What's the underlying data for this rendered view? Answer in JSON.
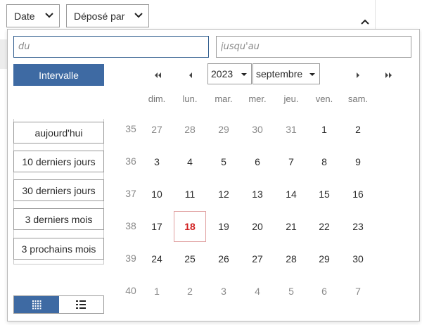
{
  "filters": {
    "date_label": "Date",
    "deposited_by_label": "Déposé par"
  },
  "inputs": {
    "from_placeholder": "du",
    "to_placeholder": "jusqu'au"
  },
  "interval_button": "Intervalle",
  "year": {
    "selected": "2023"
  },
  "month": {
    "selected": "septembre"
  },
  "presets": [
    "aujourd'hui",
    "10 derniers jours",
    "30 derniers jours",
    "3 derniers mois",
    "3 prochains mois"
  ],
  "weekdays": [
    "dim.",
    "lun.",
    "mar.",
    "mer.",
    "jeu.",
    "ven.",
    "sam."
  ],
  "weeks": [
    {
      "num": "35",
      "days": [
        {
          "d": "27",
          "other": true
        },
        {
          "d": "28",
          "other": true
        },
        {
          "d": "29",
          "other": true
        },
        {
          "d": "30",
          "other": true
        },
        {
          "d": "31",
          "other": true
        },
        {
          "d": "1"
        },
        {
          "d": "2"
        }
      ]
    },
    {
      "num": "36",
      "days": [
        {
          "d": "3"
        },
        {
          "d": "4"
        },
        {
          "d": "5"
        },
        {
          "d": "6"
        },
        {
          "d": "7"
        },
        {
          "d": "8"
        },
        {
          "d": "9"
        }
      ]
    },
    {
      "num": "37",
      "days": [
        {
          "d": "10"
        },
        {
          "d": "11"
        },
        {
          "d": "12"
        },
        {
          "d": "13"
        },
        {
          "d": "14"
        },
        {
          "d": "15"
        },
        {
          "d": "16"
        }
      ]
    },
    {
      "num": "38",
      "days": [
        {
          "d": "17"
        },
        {
          "d": "18",
          "today": true
        },
        {
          "d": "19"
        },
        {
          "d": "20"
        },
        {
          "d": "21"
        },
        {
          "d": "22"
        },
        {
          "d": "23"
        }
      ]
    },
    {
      "num": "39",
      "days": [
        {
          "d": "24"
        },
        {
          "d": "25"
        },
        {
          "d": "26"
        },
        {
          "d": "27"
        },
        {
          "d": "28"
        },
        {
          "d": "29"
        },
        {
          "d": "30"
        }
      ]
    },
    {
      "num": "40",
      "days": [
        {
          "d": "1",
          "other": true
        },
        {
          "d": "2",
          "other": true
        },
        {
          "d": "3",
          "other": true
        },
        {
          "d": "4",
          "other": true
        },
        {
          "d": "5",
          "other": true
        },
        {
          "d": "6",
          "other": true
        },
        {
          "d": "7",
          "other": true
        }
      ]
    }
  ],
  "colors": {
    "accent": "#3e6aa3",
    "today": "#d02020"
  },
  "icons": {
    "first": "double-chevron-left-icon",
    "prev": "chevron-left-icon",
    "next": "chevron-right-icon",
    "last": "double-chevron-right-icon",
    "grid_view": "grid-view-icon",
    "list_view": "list-view-icon"
  }
}
